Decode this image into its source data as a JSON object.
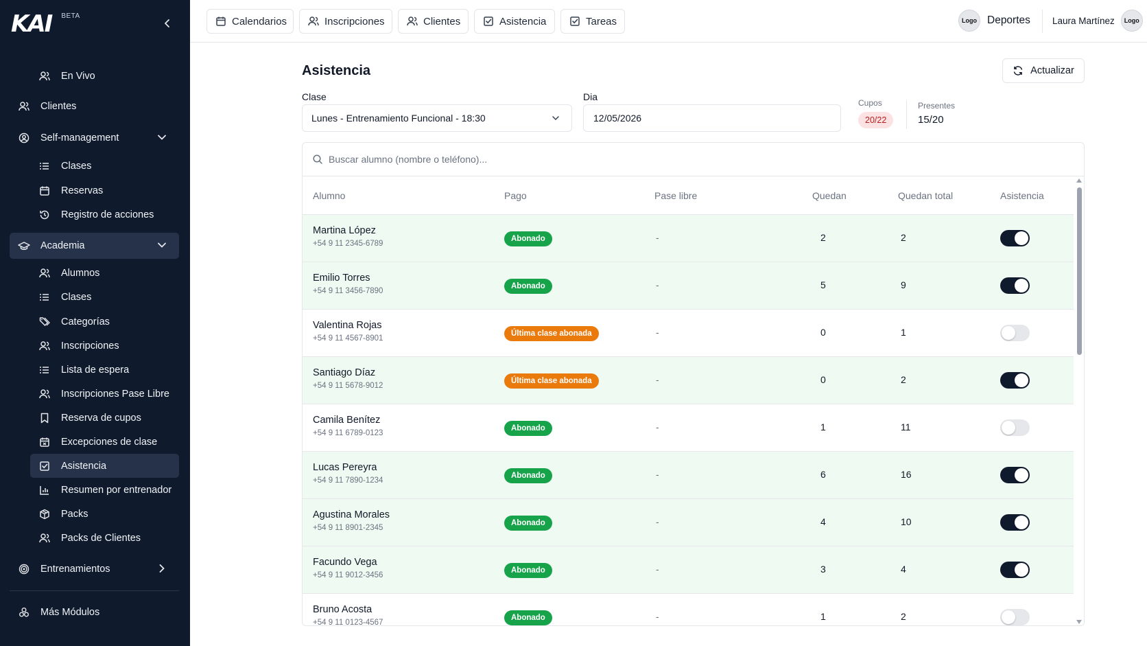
{
  "brand": {
    "logo": "KAI",
    "beta": "BETA"
  },
  "sidebar": {
    "items": [
      {
        "label": "En Vivo",
        "icon": "users-icon"
      },
      {
        "label": "Clientes",
        "icon": "users-icon"
      },
      {
        "label": "Self-management",
        "icon": "user-circle-icon"
      },
      {
        "label": "Clases",
        "icon": "list-icon"
      },
      {
        "label": "Reservas",
        "icon": "calendar-icon"
      },
      {
        "label": "Registro de acciones",
        "icon": "history-icon"
      },
      {
        "label": "Academia",
        "icon": "graduation-cap-icon"
      },
      {
        "label": "Alumnos",
        "icon": "users-icon"
      },
      {
        "label": "Clases",
        "icon": "list-icon"
      },
      {
        "label": "Categorías",
        "icon": "tags-icon"
      },
      {
        "label": "Inscripciones",
        "icon": "users-icon"
      },
      {
        "label": "Lista de espera",
        "icon": "list-icon"
      },
      {
        "label": "Inscripciones Pase Libre",
        "icon": "users-icon"
      },
      {
        "label": "Reserva de cupos",
        "icon": "bookmark-icon"
      },
      {
        "label": "Excepciones de clase",
        "icon": "calendar-x-icon"
      },
      {
        "label": "Asistencia",
        "icon": "check-square-icon"
      },
      {
        "label": "Resumen por entrenador",
        "icon": "bar-chart-icon"
      },
      {
        "label": "Packs",
        "icon": "package-icon"
      },
      {
        "label": "Packs de Clientes",
        "icon": "users-icon"
      },
      {
        "label": "Entrenamientos",
        "icon": "target-icon"
      },
      {
        "label": "Más Módulos",
        "icon": "modules-icon"
      }
    ]
  },
  "topbar": {
    "tabs": [
      {
        "label": "Calendarios",
        "icon": "calendar-icon"
      },
      {
        "label": "Inscripciones",
        "icon": "users-icon"
      },
      {
        "label": "Clientes",
        "icon": "users-icon"
      },
      {
        "label": "Asistencia",
        "icon": "check-square-icon"
      },
      {
        "label": "Tareas",
        "icon": "check-square-icon"
      }
    ],
    "org_logo": "Logo",
    "org_name": "Deportes",
    "user_name": "Laura Martínez",
    "user_logo": "Logo"
  },
  "main": {
    "title": "Asistencia",
    "refresh_label": "Actualizar",
    "clase_label": "Clase",
    "clase_value": "Lunes - Entrenamiento Funcional - 18:30",
    "dia_label": "Dia",
    "dia_value": "12/05/2026",
    "cupos_label": "Cupos",
    "cupos_value": "20/22",
    "presentes_label": "Presentes",
    "presentes_value": "15/20",
    "search_placeholder": "Buscar alumno (nombre o teléfono)..."
  },
  "table": {
    "headers": [
      "Alumno",
      "Pago",
      "Pase libre",
      "Quedan",
      "Quedan total",
      "Asistencia"
    ],
    "rows": [
      {
        "name": "Martina López",
        "phone": "+54 9 11 2345-6789",
        "pago": "Abonado",
        "pago_color": "#16a34a",
        "pase": "-",
        "quedan": "2",
        "quedan_total": "2",
        "present": true
      },
      {
        "name": "Emilio Torres",
        "phone": "+54 9 11 3456-7890",
        "pago": "Abonado",
        "pago_color": "#16a34a",
        "pase": "-",
        "quedan": "5",
        "quedan_total": "9",
        "present": true
      },
      {
        "name": "Valentina Rojas",
        "phone": "+54 9 11 4567-8901",
        "pago": "Última clase abonada",
        "pago_color": "#ea7a0c",
        "pase": "-",
        "quedan": "0",
        "quedan_total": "1",
        "present": false
      },
      {
        "name": "Santiago Díaz",
        "phone": "+54 9 11 5678-9012",
        "pago": "Última clase abonada",
        "pago_color": "#ea7a0c",
        "pase": "-",
        "quedan": "0",
        "quedan_total": "2",
        "present": true
      },
      {
        "name": "Camila Benítez",
        "phone": "+54 9 11 6789-0123",
        "pago": "Abonado",
        "pago_color": "#16a34a",
        "pase": "-",
        "quedan": "1",
        "quedan_total": "11",
        "present": false
      },
      {
        "name": "Lucas Pereyra",
        "phone": "+54 9 11 7890-1234",
        "pago": "Abonado",
        "pago_color": "#16a34a",
        "pase": "-",
        "quedan": "6",
        "quedan_total": "16",
        "present": true
      },
      {
        "name": "Agustina Morales",
        "phone": "+54 9 11 8901-2345",
        "pago": "Abonado",
        "pago_color": "#16a34a",
        "pase": "-",
        "quedan": "4",
        "quedan_total": "10",
        "present": true
      },
      {
        "name": "Facundo Vega",
        "phone": "+54 9 11 9012-3456",
        "pago": "Abonado",
        "pago_color": "#16a34a",
        "pase": "-",
        "quedan": "3",
        "quedan_total": "4",
        "present": true
      },
      {
        "name": "Bruno Acosta",
        "phone": "+54 9 11 0123-4567",
        "pago": "Abonado",
        "pago_color": "#16a34a",
        "pase": "-",
        "quedan": "1",
        "quedan_total": "2",
        "present": false
      }
    ]
  },
  "colors": {
    "sidebar_bg": "#0f1a2c",
    "present_row_bg": "#eefaf2",
    "toggle_on": "#0f1a2c"
  }
}
